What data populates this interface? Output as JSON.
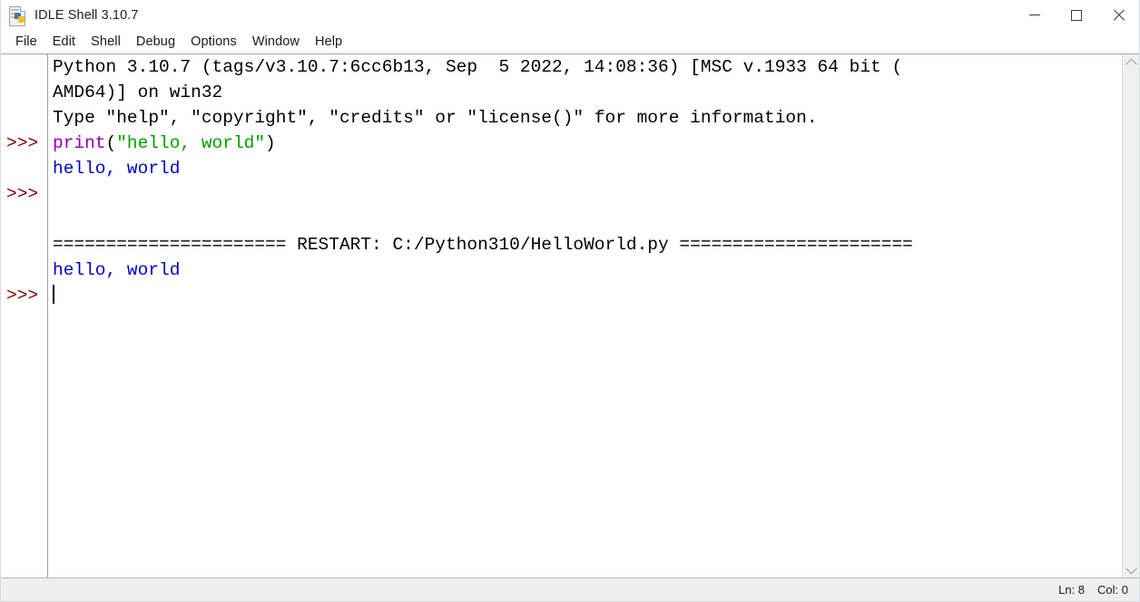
{
  "window": {
    "title": "IDLE Shell 3.10.7",
    "icon": "python-file-icon",
    "controls": {
      "minimize": "minimize-icon",
      "maximize": "maximize-icon",
      "close": "close-icon"
    }
  },
  "menubar": {
    "items": [
      {
        "label": "File"
      },
      {
        "label": "Edit"
      },
      {
        "label": "Shell"
      },
      {
        "label": "Debug"
      },
      {
        "label": "Options"
      },
      {
        "label": "Window"
      },
      {
        "label": "Help"
      }
    ]
  },
  "console": {
    "prompt": ">>>",
    "gutter_prompts": [
      "",
      "",
      "",
      ">>>",
      "",
      ">>>",
      "",
      "",
      "",
      ">>>"
    ],
    "lines": [
      {
        "prompt": "",
        "segments": [
          {
            "text": "Python 3.10.7 (tags/v3.10.7:6cc6b13, Sep  5 2022, 14:08:36) [MSC v.1933 64 bit (",
            "type": "plain"
          }
        ]
      },
      {
        "prompt": "",
        "segments": [
          {
            "text": "AMD64)] on win32",
            "type": "plain"
          }
        ]
      },
      {
        "prompt": "",
        "segments": [
          {
            "text": "Type \"help\", \"copyright\", \"credits\" or \"license()\" for more information.",
            "type": "plain"
          }
        ]
      },
      {
        "prompt": ">>>",
        "segments": [
          {
            "text": "print",
            "type": "builtin"
          },
          {
            "text": "(",
            "type": "plain"
          },
          {
            "text": "\"hello, world\"",
            "type": "string"
          },
          {
            "text": ")",
            "type": "plain"
          }
        ]
      },
      {
        "prompt": "",
        "segments": [
          {
            "text": "hello, world",
            "type": "output"
          }
        ]
      },
      {
        "prompt": ">>>",
        "segments": [
          {
            "text": "",
            "type": "plain"
          }
        ]
      },
      {
        "prompt": "",
        "segments": [
          {
            "text": "",
            "type": "plain"
          }
        ]
      },
      {
        "prompt": "",
        "segments": [
          {
            "text": "====================== RESTART: C:/Python310/HelloWorld.py ======================",
            "type": "plain"
          }
        ]
      },
      {
        "prompt": "",
        "segments": [
          {
            "text": "hello, world",
            "type": "output"
          }
        ]
      },
      {
        "prompt": ">>>",
        "segments": [
          {
            "text": "",
            "type": "plain",
            "caret": true
          }
        ]
      }
    ]
  },
  "scrollbar": {
    "up_arrow": "chevron-up-icon",
    "down_arrow": "chevron-down-icon"
  },
  "statusbar": {
    "line_label": "Ln: 8",
    "col_label": "Col: 0"
  },
  "colors": {
    "builtin": "#9000b0",
    "string": "#00a000",
    "output": "#0000cc",
    "prompt": "#800000",
    "plain": "#000000",
    "statusbar_bg": "#efefef"
  }
}
